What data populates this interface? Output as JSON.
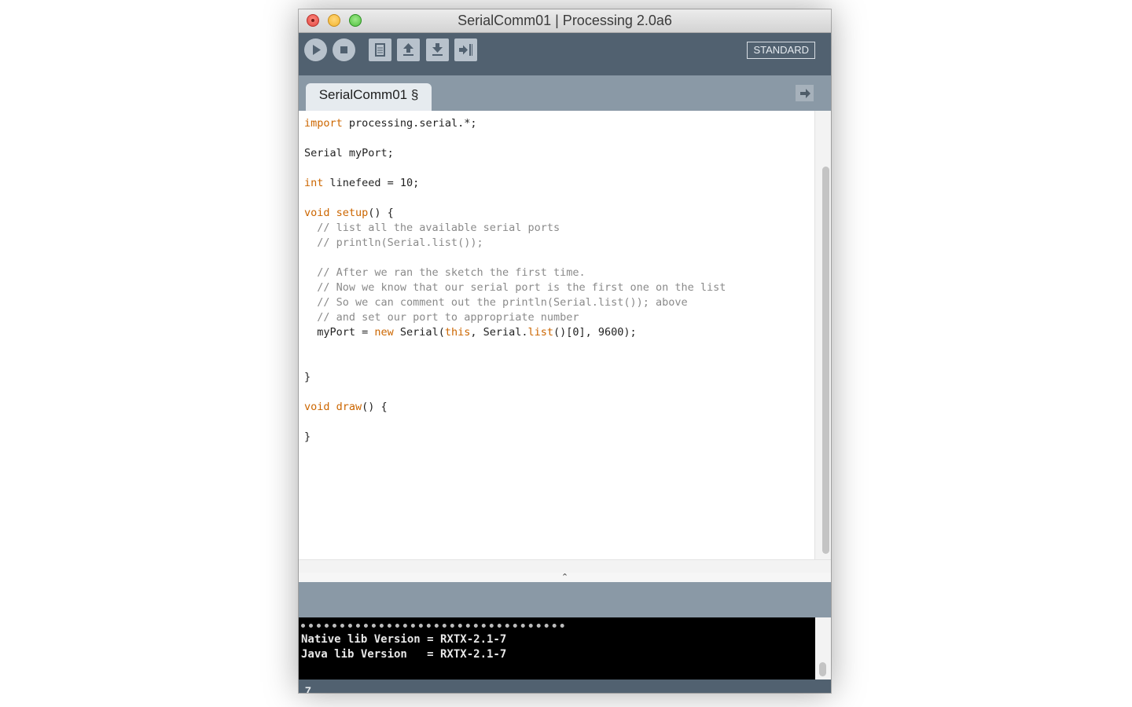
{
  "window": {
    "title": "SerialComm01 | Processing 2.0a6"
  },
  "toolbar": {
    "buttons": [
      {
        "name": "run",
        "icon": "play-icon"
      },
      {
        "name": "stop",
        "icon": "stop-icon"
      },
      {
        "name": "new",
        "icon": "new-file-icon"
      },
      {
        "name": "open",
        "icon": "open-arrow-up-icon"
      },
      {
        "name": "save",
        "icon": "save-arrow-down-icon"
      },
      {
        "name": "export",
        "icon": "export-arrow-icon"
      }
    ],
    "mode_label": "STANDARD"
  },
  "tabs": {
    "active_label": "SerialComm01 §",
    "menu_icon": "arrow-right-icon"
  },
  "editor": {
    "lines": [
      {
        "t": [
          [
            "kw",
            "import"
          ],
          [
            "",
            " processing.serial.*;"
          ]
        ]
      },
      {
        "t": []
      },
      {
        "t": [
          [
            "",
            "Serial myPort;"
          ]
        ]
      },
      {
        "t": []
      },
      {
        "t": [
          [
            "kw",
            "int"
          ],
          [
            "",
            " linefeed = 10;"
          ]
        ]
      },
      {
        "t": []
      },
      {
        "t": [
          [
            "kw",
            "void"
          ],
          [
            "",
            " "
          ],
          [
            "kw",
            "setup"
          ],
          [
            "",
            "() {"
          ]
        ]
      },
      {
        "t": [
          [
            "cm",
            "  // list all the available serial ports"
          ]
        ]
      },
      {
        "t": [
          [
            "cm",
            "  // println(Serial.list());"
          ]
        ]
      },
      {
        "t": []
      },
      {
        "t": [
          [
            "cm",
            "  // After we ran the sketch the first time."
          ]
        ]
      },
      {
        "t": [
          [
            "cm",
            "  // Now we know that our serial port is the first one on the list"
          ]
        ]
      },
      {
        "t": [
          [
            "cm",
            "  // So we can comment out the println(Serial.list()); above"
          ]
        ]
      },
      {
        "t": [
          [
            "cm",
            "  // and set our port to appropriate number"
          ]
        ]
      },
      {
        "t": [
          [
            "",
            "  myPort = "
          ],
          [
            "kw",
            "new"
          ],
          [
            "",
            " Serial("
          ],
          [
            "kw",
            "this"
          ],
          [
            "",
            ", Serial."
          ],
          [
            "kw",
            "list"
          ],
          [
            "",
            "()[0], 9600);"
          ]
        ]
      },
      {
        "t": []
      },
      {
        "t": []
      },
      {
        "t": [
          [
            "",
            "}"
          ]
        ]
      },
      {
        "t": []
      },
      {
        "t": [
          [
            "kw",
            "void"
          ],
          [
            "",
            " "
          ],
          [
            "kw",
            "draw"
          ],
          [
            "",
            "() {"
          ]
        ]
      },
      {
        "t": []
      },
      {
        "t": [
          [
            "",
            "}"
          ]
        ]
      }
    ],
    "divider_glyph": "⌃"
  },
  "console": {
    "line1": "Native lib Version = RXTX-2.1-7",
    "line2": "Java lib Version   = RXTX-2.1-7"
  },
  "status": {
    "line_number": "7"
  }
}
